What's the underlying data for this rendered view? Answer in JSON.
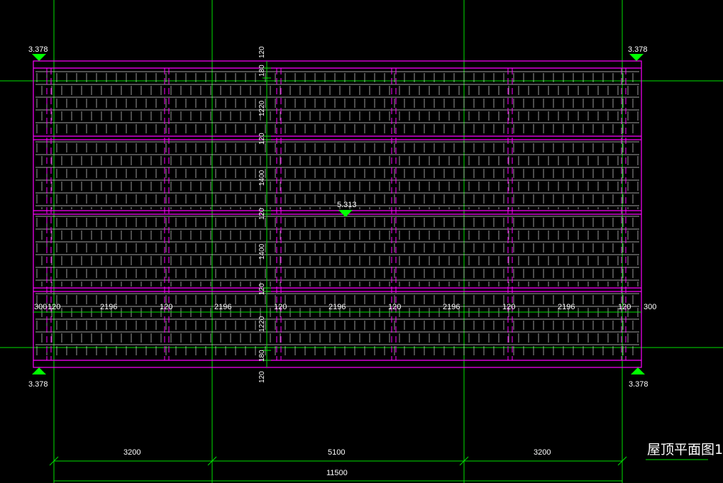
{
  "drawing": {
    "title": "屋顶平面图1:",
    "colors": {
      "background": "#000000",
      "axis": "#00ff00",
      "outline": "#ff00ff",
      "tile": "#ffffff",
      "marker": "#00ff00",
      "text": "#ffffff"
    },
    "elevations": {
      "top_left": "3.378",
      "top_right": "3.378",
      "bottom_left": "3.378",
      "bottom_right": "3.378",
      "ridge": "5.313"
    },
    "horizontal_dims": [
      "300",
      "120",
      "2196",
      "120",
      "2196",
      "120",
      "2196",
      "120",
      "2196",
      "120",
      "2196",
      "120",
      "300"
    ],
    "vertical_dims": [
      "120",
      "180",
      "1220",
      "120",
      "1400",
      "120",
      "1400",
      "120",
      "1220",
      "180",
      "120"
    ],
    "bottom_dims": [
      "3200",
      "5100",
      "3200"
    ],
    "total_dim": "11500"
  }
}
